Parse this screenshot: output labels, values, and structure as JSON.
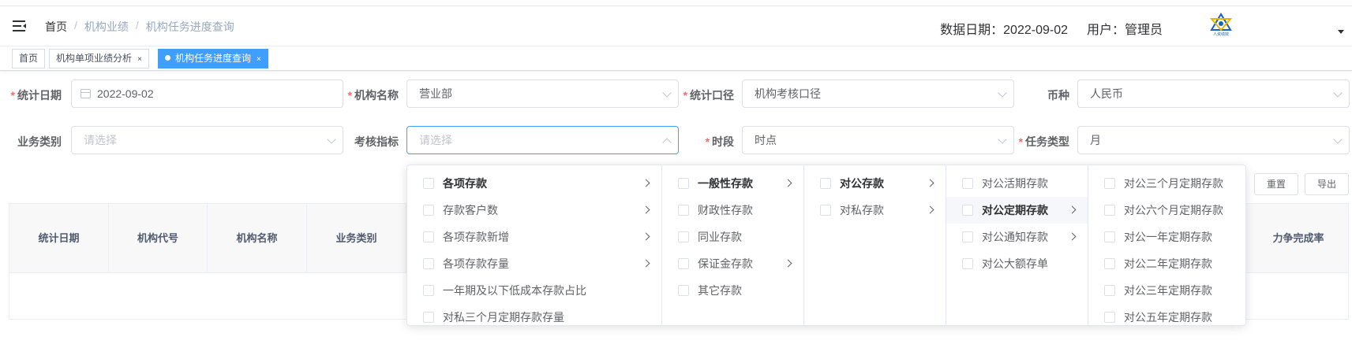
{
  "header": {
    "breadcrumb": [
      "首页",
      "机构业绩",
      "机构任务进度查询"
    ],
    "breadcrumb_sep": "/",
    "data_date": "数据日期：2022-09-02",
    "user": "用户：管理员",
    "logo_text": "人资绩效"
  },
  "tags": [
    {
      "label": "首页",
      "closable": false,
      "active": false
    },
    {
      "label": "机构单项业绩分析",
      "closable": true,
      "active": false
    },
    {
      "label": "机构任务进度查询",
      "closable": true,
      "active": true
    }
  ],
  "tag_close": "×",
  "form": {
    "stat_date": {
      "label": "统计日期",
      "value": "2022-09-02"
    },
    "org_name": {
      "label": "机构名称",
      "value": "营业部"
    },
    "stat_scope": {
      "label": "统计口径",
      "value": "机构考核口径"
    },
    "currency": {
      "label": "币种",
      "value": "人民币"
    },
    "biz_type": {
      "label": "业务类别",
      "placeholder": "请选择"
    },
    "indicator": {
      "label": "考核指标",
      "placeholder": "请选择"
    },
    "period": {
      "label": "时段",
      "value": "时点"
    },
    "task_type": {
      "label": "任务类型",
      "value": "月"
    },
    "required_mark": "*"
  },
  "buttons": {
    "reset": "重置",
    "export": "导出"
  },
  "table": {
    "columns": [
      "统计日期",
      "机构代号",
      "机构名称",
      "业务类别"
    ],
    "last_column": "力争完成率"
  },
  "cascader": {
    "panels": [
      [
        {
          "label": "各项存款",
          "has_children": true,
          "state": "active"
        },
        {
          "label": "存款客户数",
          "has_children": true
        },
        {
          "label": "各项存款新增",
          "has_children": true
        },
        {
          "label": "各项存款存量",
          "has_children": true
        },
        {
          "label": "一年期及以下低成本存款占比",
          "has_children": false
        },
        {
          "label": "对私三个月定期存款存量",
          "has_children": false
        }
      ],
      [
        {
          "label": "一般性存款",
          "has_children": true,
          "state": "active"
        },
        {
          "label": "财政性存款",
          "has_children": false
        },
        {
          "label": "同业存款",
          "has_children": false
        },
        {
          "label": "保证金存款",
          "has_children": true
        },
        {
          "label": "其它存款",
          "has_children": false
        }
      ],
      [
        {
          "label": "对公存款",
          "has_children": true,
          "state": "active"
        },
        {
          "label": "对私存款",
          "has_children": true
        }
      ],
      [
        {
          "label": "对公活期存款",
          "has_children": false
        },
        {
          "label": "对公定期存款",
          "has_children": true,
          "state": "active"
        },
        {
          "label": "对公通知存款",
          "has_children": true
        },
        {
          "label": "对公大额存单",
          "has_children": false
        }
      ],
      [
        {
          "label": "对公三个月定期存款",
          "has_children": false
        },
        {
          "label": "对公六个月定期存款",
          "has_children": false
        },
        {
          "label": "对公一年定期存款",
          "has_children": false
        },
        {
          "label": "对公二年定期存款",
          "has_children": false
        },
        {
          "label": "对公三年定期存款",
          "has_children": false
        },
        {
          "label": "对公五年定期存款",
          "has_children": false
        }
      ]
    ]
  },
  "colors": {
    "primary": "#409eff",
    "required": "#f56c6c",
    "border": "#dcdfe6"
  }
}
